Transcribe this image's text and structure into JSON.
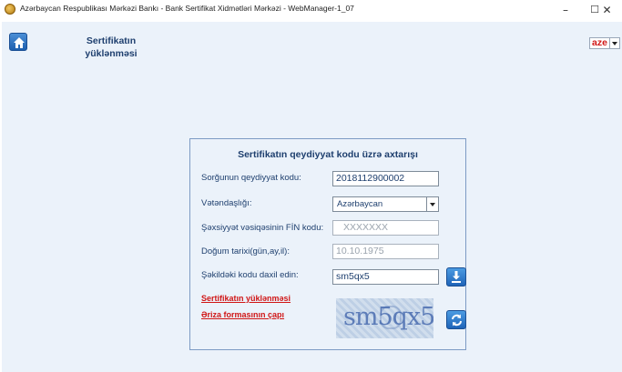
{
  "window": {
    "title": "Azərbaycan Respublikası Mərkəzi Bankı - Bank Sertifikat Xidmətləri Mərkəzi - WebManager-1_07",
    "minimize": "–",
    "maximize": "☐",
    "close": "✕"
  },
  "header": {
    "home_icon": "home-icon",
    "page_title_line1": "Sertifikatın",
    "page_title_line2": "yüklənməsi",
    "language": "aze"
  },
  "form": {
    "heading": "Sertifikatın qeydiyyat kodu üzrə axtarışı",
    "registration_code_label": "Sorğunun qeydiyyat kodu:",
    "registration_code_value": "2018112900002",
    "citizenship_label": "Vətəndaşlığı:",
    "citizenship_value": "Azərbaycan",
    "fin_label": "Şəxsiyyət vəsiqəsinin FİN kodu:",
    "fin_value": "XXXXXXX",
    "birth_date_label": "Doğum tarixi(gün,ay,il):",
    "birth_date_value": "10.10.1975",
    "captcha_label": "Şəkildəki kodu daxil edin:",
    "captcha_value": "sm5qx5",
    "captcha_image_text": "sm5qx5",
    "download_link": "Sertifikatın yüklənməsi",
    "print_link": "Əriza formasının çapı",
    "download_icon": "download-icon",
    "refresh_icon": "refresh-icon"
  },
  "colors": {
    "background": "#ebf2fa",
    "heading_text": "#1e3f6e",
    "link_red": "#d01616",
    "button_blue": "#1f64b8"
  }
}
